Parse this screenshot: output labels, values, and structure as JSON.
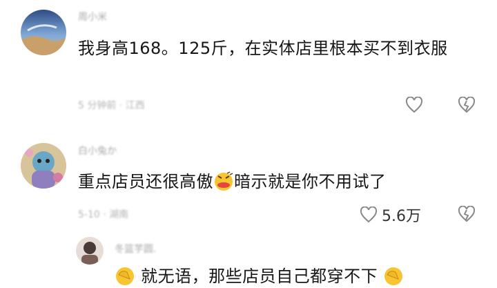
{
  "comments": [
    {
      "username": "周小米",
      "text": "我身高168。125斤，在实体店里根本买不到衣服",
      "meta": "5 分钟前 · 江西"
    },
    {
      "username": "白小兔か",
      "text_before": "重点店员还很高傲",
      "text_after": "暗示就是你不用试了",
      "meta": "5-10 · 湖南",
      "like_count": "5.6万"
    },
    {
      "username": "冬篮芋圆.",
      "text": "就无语，那些店员自己都穿不下"
    }
  ],
  "icons": {
    "like": "heart-outline-icon",
    "dislike": "broken-heart-icon",
    "emoji_pouting": "pouting-face-emoji-icon",
    "emoji_facepalm": "facepalm-emoji-icon"
  }
}
